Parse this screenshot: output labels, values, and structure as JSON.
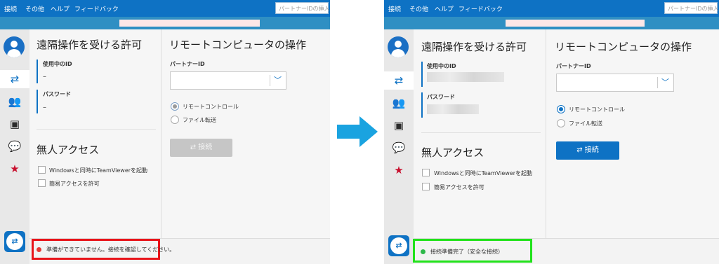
{
  "colors": {
    "brand_blue": "#0e72c4",
    "strip_blue": "#2f8fc3",
    "status_red": "#e53935",
    "status_green": "#2db84a",
    "highlight_red": "#e8141a",
    "highlight_green": "#21e21b",
    "arrow_blue": "#1aa3e0"
  },
  "menu": [
    "接続",
    "その他",
    "ヘルプ",
    "フィードバック"
  ],
  "search_placeholder": "パートナーIDの挿入",
  "sidebar_icons": [
    "avatar-icon",
    "arrows-icon",
    "people-icon",
    "contacts-icon",
    "chat-icon",
    "augmented-reality-icon",
    "teamviewer-logo-icon"
  ],
  "left": {
    "allow_title": "遠隔操作を受ける許可",
    "your_id_label": "使用中のID",
    "your_id_value": "–",
    "password_label": "パスワード",
    "password_value": "–",
    "unattended_title": "無人アクセス",
    "checkbox1": "Windowsと同時にTeamViewerを起動",
    "checkbox2": "簡易アクセスを許可",
    "remote_title": "リモートコンピュータの操作",
    "partner_id_label": "パートナーID",
    "radio_remote": "リモートコントロール",
    "radio_file": "ファイル転送",
    "connect_button": "接続",
    "status_text": "準備ができていません。接続を確認してください。"
  },
  "right": {
    "allow_title": "遠隔操作を受ける許可",
    "your_id_label": "使用中のID",
    "password_label": "パスワード",
    "unattended_title": "無人アクセス",
    "checkbox1": "Windowsと同時にTeamViewerを起動",
    "checkbox2": "簡易アクセスを許可",
    "remote_title": "リモートコンピュータの操作",
    "partner_id_label": "パートナーID",
    "radio_remote": "リモートコントロール",
    "radio_file": "ファイル転送",
    "connect_button": "接続",
    "status_text": "接続準備完了（安全な接続）"
  }
}
